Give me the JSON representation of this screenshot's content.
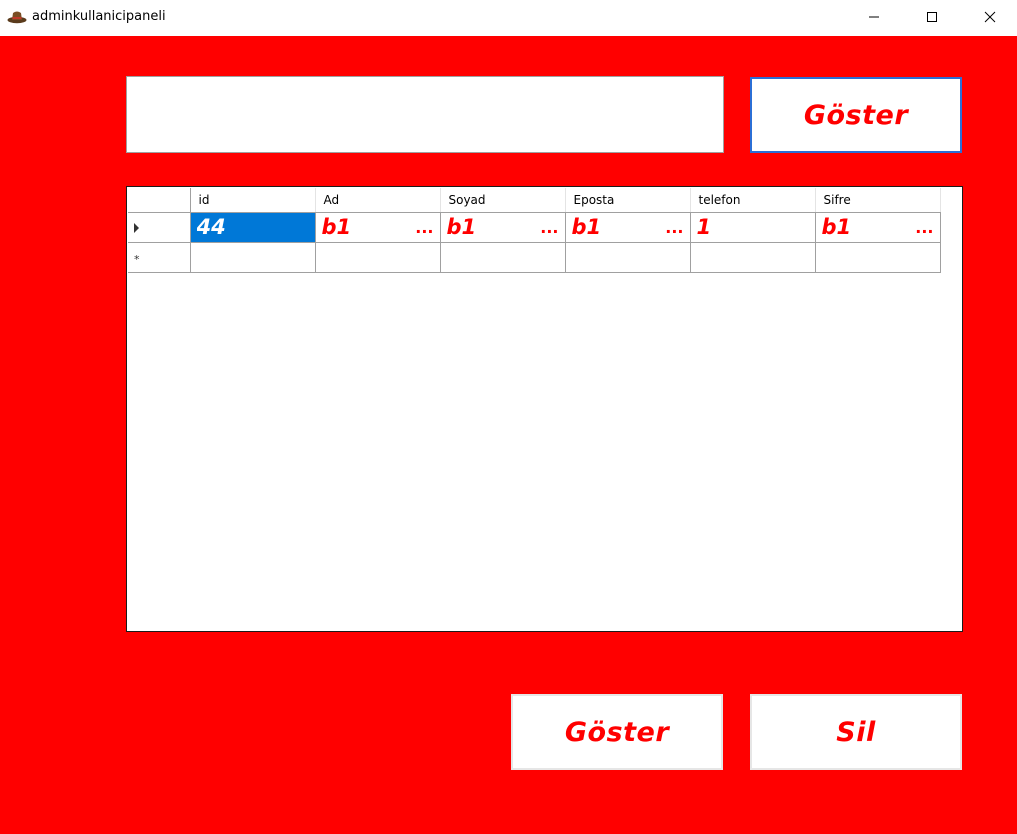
{
  "window": {
    "title": "adminkullanicipaneli",
    "icon": "hat-icon",
    "controls": [
      "minimize-icon",
      "maximize-icon",
      "close-icon"
    ]
  },
  "search": {
    "value": "",
    "placeholder": ""
  },
  "buttons": {
    "top_show": "Göster",
    "bottom_show": "Göster",
    "delete": "Sil"
  },
  "grid": {
    "columns": [
      "id",
      "Ad",
      "Soyad",
      "Eposta",
      "telefon",
      "Sifre"
    ],
    "rows": [
      {
        "id": "44",
        "ad": "b1",
        "soyad": "b1",
        "eposta": "b1",
        "telefon": "1",
        "sifre": "b1"
      }
    ],
    "ellipsis": "...",
    "new_row_marker": "*"
  },
  "colors": {
    "background": "#ff0000",
    "accent": "#0078d7",
    "button_text": "#ff0000"
  }
}
